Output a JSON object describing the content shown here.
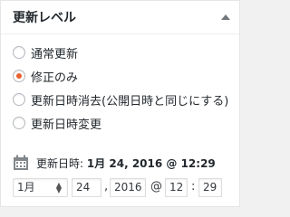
{
  "panel": {
    "title": "更新レベル",
    "options": [
      {
        "label": "通常更新",
        "checked": false
      },
      {
        "label": "修正のみ",
        "checked": true
      },
      {
        "label": "更新日時消去(公開日時と同じにする)",
        "checked": false
      },
      {
        "label": "更新日時変更",
        "checked": false
      }
    ],
    "date_label": "更新日時: ",
    "date_value": "1月 24, 2016 @ 12:29",
    "month": "1月",
    "day": "24",
    "comma": ",",
    "year": "2016",
    "at": "@",
    "hour": "12",
    "colon": ":",
    "minute": "29"
  },
  "colors": {
    "accent": "#e96030",
    "border": "#e5e5e5"
  },
  "icons": {
    "toggle": "triangle-up-icon",
    "calendar": "calendar-icon"
  }
}
